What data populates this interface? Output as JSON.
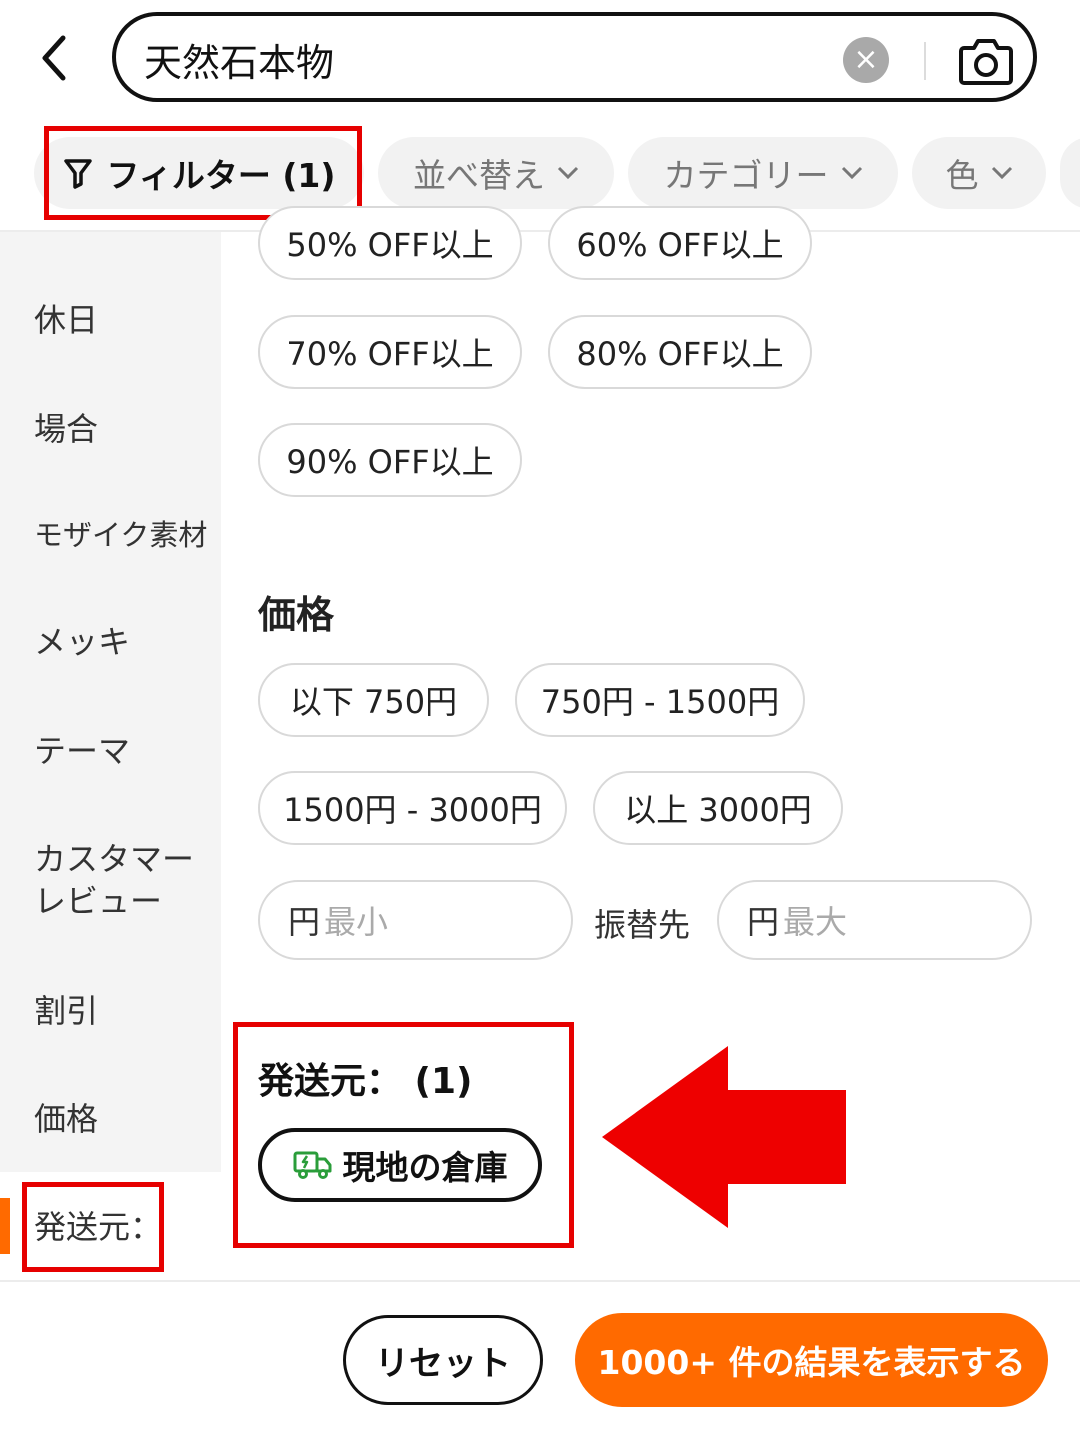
{
  "search": {
    "query": "天然石本物",
    "clear_glyph": "×",
    "icons": [
      "back-arrow-icon",
      "clear-icon",
      "camera-icon"
    ]
  },
  "toolbar": {
    "filter_label": "フィルター (1)",
    "sort_label": "並べ替え",
    "category_label": "カテゴリー",
    "color_label": "色"
  },
  "sidebar": {
    "items": [
      "休日",
      "場合",
      "モザイク素材",
      "メッキ",
      "テーマ",
      "カスタマー\nレビュー",
      "割引",
      "価格",
      "発送元："
    ],
    "active_index": 8
  },
  "discount": {
    "options": [
      "50% OFF以上",
      "60% OFF以上",
      "70% OFF以上",
      "80% OFF以上",
      "90% OFF以上"
    ]
  },
  "price": {
    "title": "価格",
    "options": [
      "以下 750円",
      "750円 - 1500円",
      "1500円 - 3000円",
      "以上 3000円"
    ],
    "currency": "円",
    "min_placeholder": "最小",
    "max_placeholder": "最大",
    "range_separator": "振替先"
  },
  "ship_from": {
    "title": "発送元： (1)",
    "option_label": "現地の倉庫",
    "option_icon": "truck-icon",
    "selected": true
  },
  "footer": {
    "reset_label": "リセット",
    "show_results_label": "1000+ 件の結果を表示する"
  },
  "colors": {
    "accent": "#ff6a00",
    "annotation": "#e60000",
    "truck_icon": "#2a9d3a"
  }
}
